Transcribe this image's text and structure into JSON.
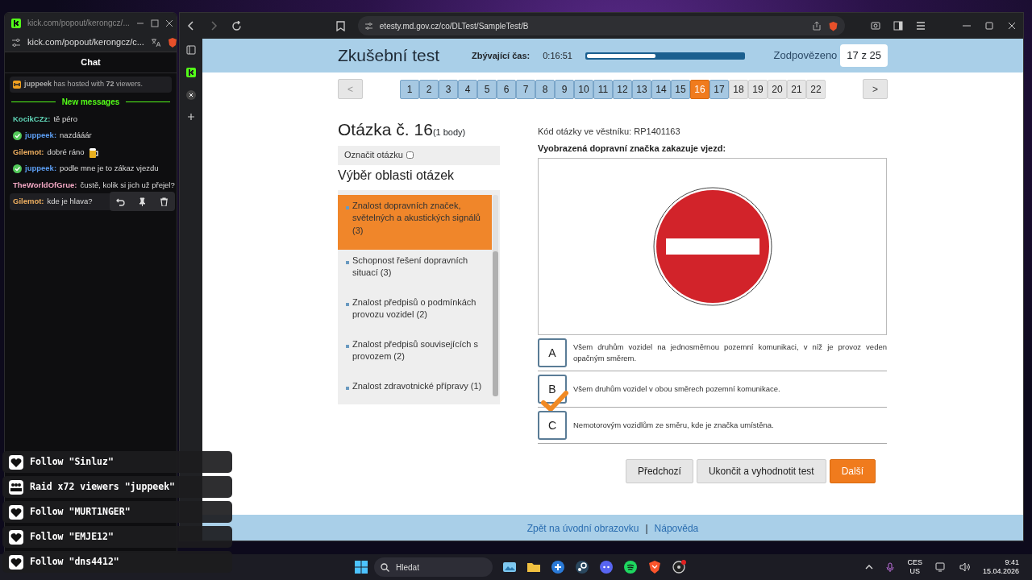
{
  "chat_window": {
    "title": "kick.com/popout/kerongcz/...",
    "address": "kick.com/popout/kerongcz/c...",
    "heading": "Chat",
    "host_notice": "**juppeek** has hosted with **72** viewers.",
    "divider": "New messages",
    "messages": [
      {
        "user": "KocikCZz:",
        "color": "#5fd3b5",
        "verified": false,
        "text": "tě péro",
        "emote": false,
        "hovered": false
      },
      {
        "user": "juppeek:",
        "color": "#5b9cf0",
        "verified": true,
        "text": "nazdááár",
        "emote": false,
        "hovered": false
      },
      {
        "user": "Gilemot:",
        "color": "#f0b060",
        "verified": false,
        "text": "dobré ráno",
        "emote": true,
        "hovered": false
      },
      {
        "user": "juppeek:",
        "color": "#5b9cf0",
        "verified": true,
        "text": "podle mne je to zákaz vjezdu",
        "emote": false,
        "hovered": false
      },
      {
        "user": "TheWorldOfGrue:",
        "color": "#f2a7c3",
        "verified": false,
        "text": "čustě, kolik si jich už přejel?",
        "emote": false,
        "hovered": false
      },
      {
        "user": "Gilemot:",
        "color": "#f0b060",
        "verified": false,
        "text": "kde je hlava?",
        "emote": false,
        "hovered": true
      }
    ]
  },
  "alerts": [
    {
      "kind": "follow",
      "text": "Follow \"Sinluz\""
    },
    {
      "kind": "raid",
      "text": "Raid x72 viewers \"juppeek\""
    },
    {
      "kind": "follow",
      "text": "Follow \"MURT1NGER\""
    },
    {
      "kind": "follow",
      "text": "Follow \"EMJE12\""
    },
    {
      "kind": "follow",
      "text": "Follow \"dns4412\""
    }
  ],
  "browser": {
    "address": "etesty.md.gov.cz/co/DLTest/SampleTest/B"
  },
  "test": {
    "title": "Zkušební test",
    "timer_label": "Zbývající čas:",
    "time": "0:16:51",
    "time_bar": {
      "level": 0.44
    },
    "answered_label": "Zodpovězeno",
    "answered": "17 z 25",
    "prev_page": "<",
    "next_page": ">",
    "questions": [
      {
        "label": "1",
        "answered": true,
        "selected": false
      },
      {
        "label": "2",
        "answered": true,
        "selected": false
      },
      {
        "label": "3",
        "answered": true,
        "selected": false
      },
      {
        "label": "4",
        "answered": true,
        "selected": false
      },
      {
        "label": "5",
        "answered": true,
        "selected": false
      },
      {
        "label": "6",
        "answered": true,
        "selected": false
      },
      {
        "label": "7",
        "answered": true,
        "selected": false
      },
      {
        "label": "8",
        "answered": true,
        "selected": false
      },
      {
        "label": "9",
        "answered": true,
        "selected": false
      },
      {
        "label": "10",
        "answered": true,
        "selected": false
      },
      {
        "label": "11",
        "answered": true,
        "selected": false
      },
      {
        "label": "12",
        "answered": true,
        "selected": false
      },
      {
        "label": "13",
        "answered": true,
        "selected": false
      },
      {
        "label": "14",
        "answered": true,
        "selected": false
      },
      {
        "label": "15",
        "answered": true,
        "selected": false
      },
      {
        "label": "16",
        "answered": true,
        "selected": true
      },
      {
        "label": "17",
        "answered": true,
        "selected": false
      },
      {
        "label": "18",
        "answered": false,
        "selected": false
      },
      {
        "label": "19",
        "answered": false,
        "selected": false
      },
      {
        "label": "20",
        "answered": false,
        "selected": false
      },
      {
        "label": "21",
        "answered": false,
        "selected": false
      },
      {
        "label": "22",
        "answered": false,
        "selected": false
      }
    ],
    "question": {
      "heading": "Otázka č. 16",
      "points": "(1 body)",
      "flag_label": "Označit otázku",
      "flagged": false,
      "code": "Kód otázky ve věstníku: RP1401163",
      "text": "Vyobrazená dopravní značka zakazuje vjezd:"
    },
    "areas_heading": "Výběr oblasti otázek",
    "areas": [
      {
        "label": "Znalost dopravních značek, světelných a akustických signálů (3)",
        "selected": true
      },
      {
        "label": "Schopnost řešení dopravních situací (3)",
        "selected": false
      },
      {
        "label": "Znalost předpisů o podmínkách provozu vozidel (2)",
        "selected": false
      },
      {
        "label": "Znalost předpisů souvisejících s provozem (2)",
        "selected": false
      },
      {
        "label": "Znalost zdravotnické přípravy (1)",
        "selected": false
      }
    ],
    "answers": [
      {
        "letter": "A",
        "text": "Všem druhům vozidel na jednosměrnou pozemní komunikaci, v níž je provoz veden opačným směrem.",
        "selected": false
      },
      {
        "letter": "B",
        "text": "Všem druhům vozidel v obou směrech pozemní komunikace.",
        "selected": true
      },
      {
        "letter": "C",
        "text": "Nemotorovým vozidlům ze směru, kde je značka umístěna.",
        "selected": false
      }
    ],
    "buttons": [
      {
        "label": "Předchozí",
        "kind": "default"
      },
      {
        "label": "Ukončit a vyhodnotit test",
        "kind": "default"
      },
      {
        "label": "Další",
        "kind": "primary"
      }
    ],
    "footer": {
      "links": [
        "Zpět na úvodní obrazovku",
        "Nápověda"
      ],
      "separator": "|"
    }
  },
  "taskbar": {
    "search": "Hledat",
    "language": "CES",
    "layout": "US",
    "time": "9:41",
    "date": "15.04.2026"
  }
}
